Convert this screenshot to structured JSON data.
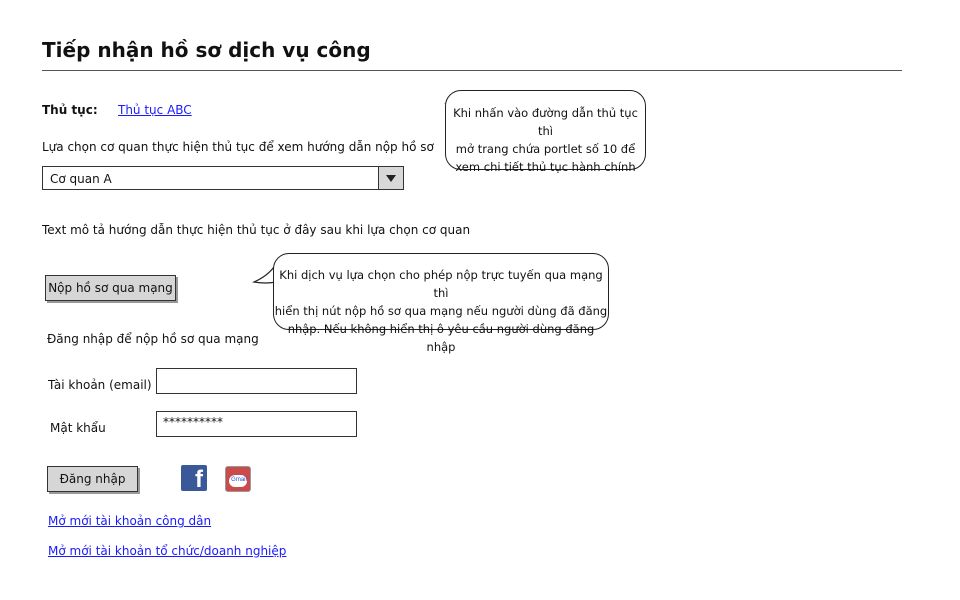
{
  "page": {
    "title": "Tiếp nhận hồ sơ dịch vụ công"
  },
  "procedure": {
    "label": "Thủ tục:",
    "link_text": "Thủ tục ABC"
  },
  "agency": {
    "prompt": "Lựa chọn cơ quan thực hiện thủ tục để xem hướng dẫn nộp hồ sơ",
    "selected": "Cơ quan A"
  },
  "description_text": "Text mô tả hướng dẫn thực hiện thủ tục ở đây sau khi lựa chọn cơ quan",
  "submit_online_button": "Nộp hồ sơ qua mạng",
  "login": {
    "heading": "Đăng nhập để nộp hồ sơ qua mạng",
    "account_label": "Tài khoản (email)",
    "account_value": "",
    "password_label": "Mật khẩu",
    "password_value": "**********",
    "login_button": "Đăng nhập"
  },
  "social": {
    "facebook_icon": "facebook-icon",
    "gmail_icon": "gmail-icon",
    "facebook_letter": "f",
    "gmail_text": "Gmail"
  },
  "register_links": {
    "citizen": "Mở mới tài khoản công dân",
    "organization": "Mở mới tài khoản tổ chức/doanh nghiệp"
  },
  "notes": {
    "procedure_link_note": [
      "Khi nhấn vào đường dẫn thủ tục thì",
      "mở trang chứa portlet số 10 để",
      "xem chi tiết thủ tục hành chính"
    ],
    "submit_online_note": [
      "Khi dịch vụ lựa chọn cho phép nộp trực tuyến qua mạng thì",
      "hiển thị nút nộp hồ sơ qua mạng nếu người dùng đã đăng",
      "nhập. Nếu không hiển thị ô yêu cầu người dùng đăng nhập"
    ]
  }
}
